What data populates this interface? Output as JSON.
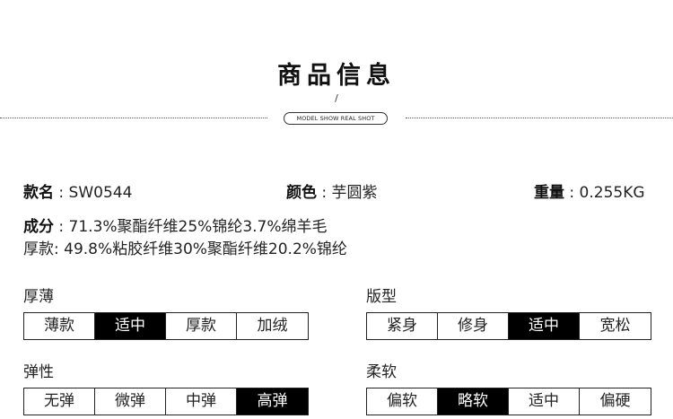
{
  "header": {
    "title": "商品信息",
    "slash": "/",
    "subtitle": "MODEL SHOW REAL SHOT"
  },
  "info": {
    "style_label": "款名",
    "style_value": " : SW0544",
    "color_label": "颜色",
    "color_value": " : 芋圆紫",
    "weight_label": "重量",
    "weight_value": " : 0.255KG",
    "composition_label": "成分",
    "composition_value": " : 71.3%聚酯纤维25%锦纶3.7%绵羊毛",
    "lining_text": "厚款: 49.8%粘胶纤维30%聚酯纤维20.2%锦纶"
  },
  "groups": [
    {
      "label": "厚薄",
      "options": [
        "薄款",
        "适中",
        "厚款",
        "加绒"
      ],
      "selected": 1
    },
    {
      "label": "版型",
      "options": [
        "紧身",
        "修身",
        "适中",
        "宽松"
      ],
      "selected": 2
    },
    {
      "label": "弹性",
      "options": [
        "无弹",
        "微弹",
        "中弹",
        "高弹"
      ],
      "selected": 3
    },
    {
      "label": "柔软",
      "options": [
        "偏软",
        "略软",
        "适中",
        "偏硬"
      ],
      "selected": 1
    }
  ]
}
